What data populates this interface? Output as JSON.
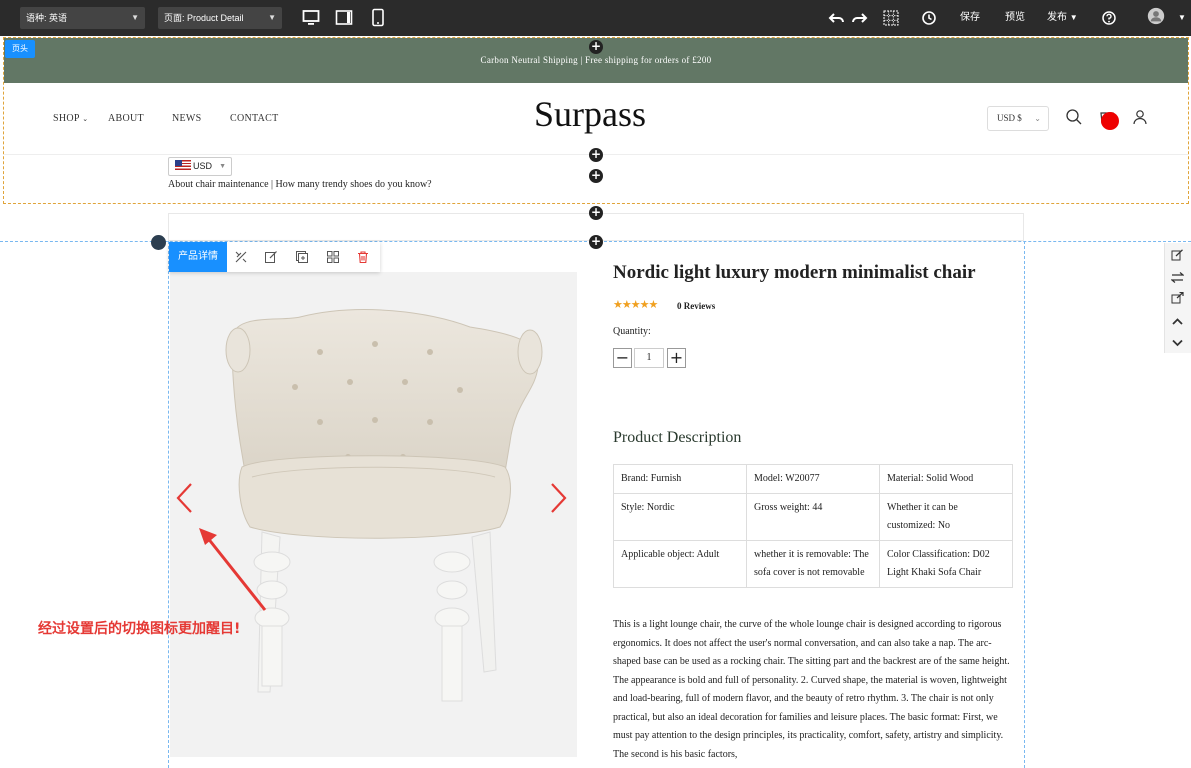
{
  "editor": {
    "language_select": "语种: 英语",
    "page_select": "页面: Product Detail",
    "save": "保存",
    "preview": "预览",
    "publish": "发布",
    "icons": [
      "undo-icon",
      "redo-icon",
      "grid-icon",
      "history-icon",
      "help-icon",
      "avatar-icon"
    ],
    "devices": [
      "desktop-icon",
      "tablet-icon",
      "mobile-icon"
    ]
  },
  "header_tag": "页头",
  "announcement": "Carbon Neutral Shipping | Free shipping for orders of £200",
  "nav": {
    "links": [
      "SHOP",
      "ABOUT",
      "NEWS",
      "CONTACT"
    ],
    "logo": "Surpass",
    "currency": "USD $",
    "currency_chip": "USD",
    "sub_links": "About chair maintenance | How many trendy shoes do you know?"
  },
  "toolbar": {
    "label": "产品详情",
    "icons": [
      "style-icon",
      "edit-icon",
      "copy-icon",
      "layout-icon",
      "delete-icon"
    ]
  },
  "product": {
    "title": "Nordic light luxury modern minimalist chair",
    "stars": "★★★★★",
    "reviews": "0 Reviews",
    "quantity_label": "Quantity:",
    "quantity": "1",
    "description_heading": "Product Description",
    "specs": [
      [
        "Brand: Furnish",
        "Model: W20077",
        "Material: Solid Wood"
      ],
      [
        "Style: Nordic",
        "Gross weight: 44",
        "Whether it can be customized: No"
      ],
      [
        "Applicable object: Adult",
        "whether it is removable: The sofa cover is not removable",
        "Color Classification: D02 Light Khaki Sofa Chair"
      ]
    ],
    "body": "This is a light lounge chair, the curve of the whole lounge chair is designed according to rigorous ergonomics. It does not affect the user's normal conversation, and can also take a nap. The arc-shaped base can be used as a rocking chair. The sitting part and the backrest are of the same height. The appearance is bold and full of personality. 2. Curved shape, the material is woven, lightweight and load-bearing, full of modern flavor, and the beauty of retro rhythm. 3. The chair is not only practical, but also an ideal decoration for families and leisure places. The basic format: First, we must pay attention to the design principles, its practicality, comfort, safety, artistry and simplicity. The second is his basic factors,"
  },
  "annotation": "经过设置后的切换图标更加醒目!",
  "colors": {
    "accent": "#1890ff",
    "announce_bg": "#627765",
    "arrow": "#e53935"
  }
}
